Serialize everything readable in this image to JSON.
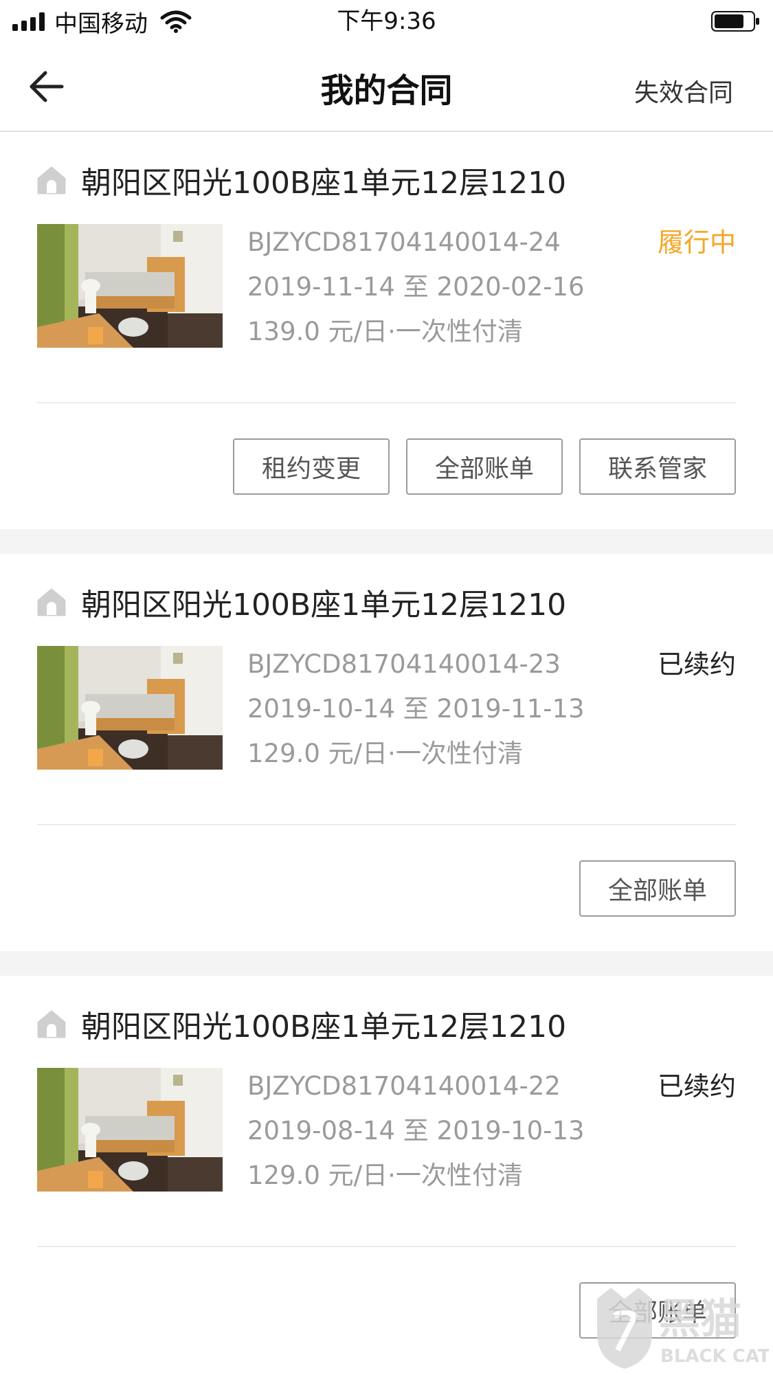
{
  "status_bar": {
    "carrier": "中国移动",
    "time": "下午9:36"
  },
  "header": {
    "title": "我的合同",
    "right_action": "失效合同"
  },
  "contracts": [
    {
      "address": "朝阳区阳光100B座1单元12层1210",
      "contract_no": "BJZYCD81704140014-24",
      "period": "2019-11-14 至 2020-02-16",
      "price": "139.0 元/日·一次性付清",
      "status": "履行中",
      "status_color": "#f5a623",
      "buttons": [
        "租约变更",
        "全部账单",
        "联系管家"
      ]
    },
    {
      "address": "朝阳区阳光100B座1单元12层1210",
      "contract_no": "BJZYCD81704140014-23",
      "period": "2019-10-14 至 2019-11-13",
      "price": "129.0 元/日·一次性付清",
      "status": "已续约",
      "status_color": "#222222",
      "buttons": [
        "全部账单"
      ]
    },
    {
      "address": "朝阳区阳光100B座1单元12层1210",
      "contract_no": "BJZYCD81704140014-22",
      "period": "2019-08-14 至 2019-10-13",
      "price": "129.0 元/日·一次性付清",
      "status": "已续约",
      "status_color": "#222222",
      "buttons": [
        "全部账单"
      ]
    }
  ],
  "watermark": {
    "cn": "黑猫",
    "en": "BLACK CAT"
  },
  "icons": {
    "back": "arrow-left-icon",
    "house": "house-icon",
    "wifi": "wifi-icon",
    "battery": "battery-icon"
  }
}
